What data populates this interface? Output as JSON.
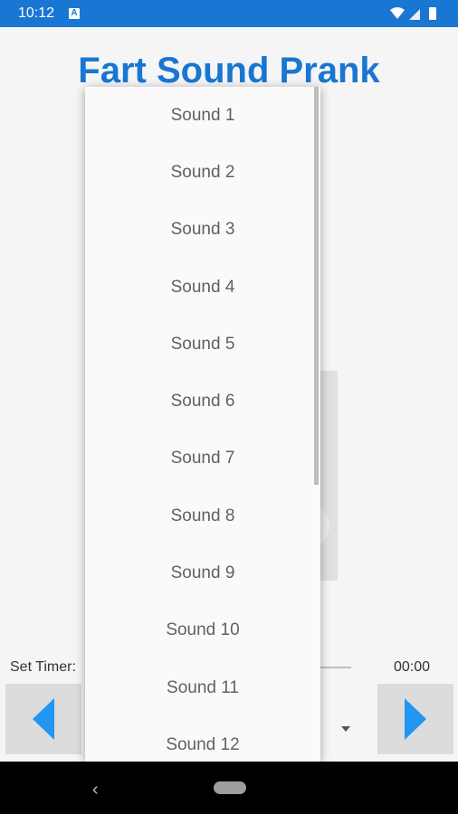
{
  "status_bar": {
    "time": "10:12",
    "notification_icon": "A",
    "icons": [
      "wifi-icon",
      "signal-icon",
      "battery-icon"
    ]
  },
  "app": {
    "title": "Fart Sound Prank",
    "accent_color": "#1976d2"
  },
  "timer": {
    "label": "Set Timer:",
    "value": "00:00"
  },
  "controls": {
    "prev_icon": "triangle-left-icon",
    "next_icon": "triangle-right-icon",
    "button_color": "#2196f3"
  },
  "dropdown": {
    "items": [
      "Sound 1",
      "Sound 2",
      "Sound 3",
      "Sound 4",
      "Sound 5",
      "Sound 6",
      "Sound 7",
      "Sound 8",
      "Sound 9",
      "Sound 10",
      "Sound 11",
      "Sound 12"
    ]
  },
  "system_nav": {
    "back_icon": "back-icon",
    "home_icon": "home-pill-icon"
  }
}
